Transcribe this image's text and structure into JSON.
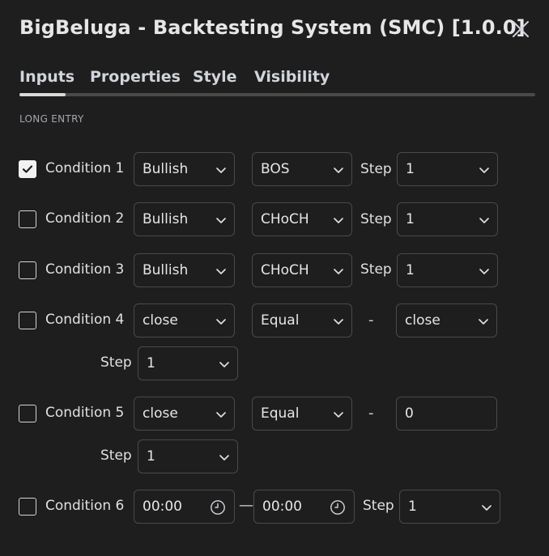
{
  "window": {
    "title": "BigBeluga - Backtesting System (SMC) [1.0.0]"
  },
  "tabs": [
    {
      "label": "Inputs",
      "active": true
    },
    {
      "label": "Properties",
      "active": false
    },
    {
      "label": "Style",
      "active": false
    },
    {
      "label": "Visibility",
      "active": false
    }
  ],
  "section": {
    "label": "LONG ENTRY"
  },
  "conditions": [
    {
      "label": "Condition 1",
      "checked": true,
      "select_a": "Bullish",
      "select_b": "BOS",
      "step_label": "Step",
      "step_value": "1"
    },
    {
      "label": "Condition 2",
      "checked": false,
      "select_a": "Bullish",
      "select_b": "CHoCH",
      "step_label": "Step",
      "step_value": "1"
    },
    {
      "label": "Condition 3",
      "checked": false,
      "select_a": "Bullish",
      "select_b": "CHoCH",
      "step_label": "Step",
      "step_value": "1"
    },
    {
      "label": "Condition 4",
      "checked": false,
      "select_a": "close",
      "select_b": "Equal",
      "separator": "-",
      "select_c": "close",
      "step_label": "Step",
      "step_value": "1"
    },
    {
      "label": "Condition 5",
      "checked": false,
      "select_a": "close",
      "select_b": "Equal",
      "separator": "-",
      "input_value": "0",
      "step_label": "Step",
      "step_value": "1"
    },
    {
      "label": "Condition 6",
      "checked": false,
      "time_start": "00:00",
      "time_separator": "—",
      "time_end": "00:00",
      "step_label": "Step",
      "step_value": "1"
    }
  ],
  "colors": {
    "background": "#1e1e1e",
    "border": "#4a4a4a",
    "text": "#e0e0e0",
    "muted_text": "#a3a6af",
    "active_tab_indicator": "#d9d9d9"
  },
  "icons": {
    "close": "close-icon",
    "chevron": "chevron-down-icon",
    "clock": "clock-icon",
    "check": "check-icon"
  }
}
